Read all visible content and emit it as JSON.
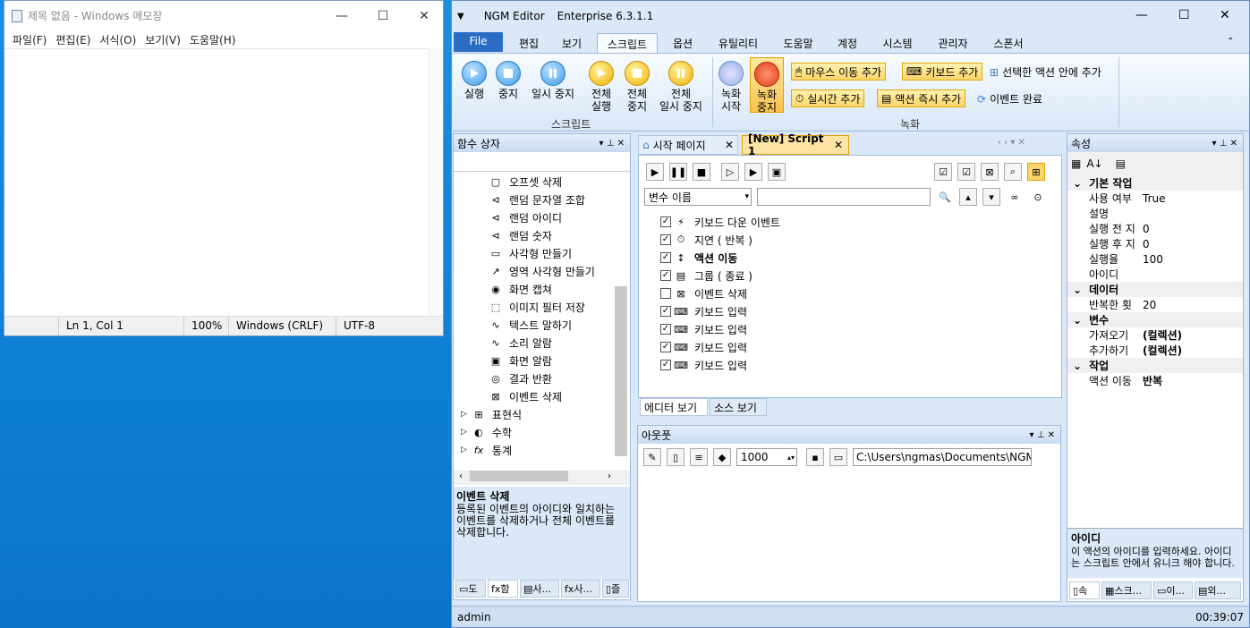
{
  "notepad": {
    "title": "제목 없음 - Windows 메모장",
    "menu": [
      "파일(F)",
      "편집(E)",
      "서식(O)",
      "보기(V)",
      "도움말(H)"
    ],
    "status": {
      "pos": "Ln 1, Col 1",
      "zoom": "100%",
      "eol": "Windows (CRLF)",
      "enc": "UTF-8"
    }
  },
  "ngm": {
    "app": "NGM Editor",
    "edition": "Enterprise 6.3.1.1",
    "tabs": [
      "File",
      "편집",
      "보기",
      "스크립트",
      "옵션",
      "유틸리티",
      "도움말",
      "계정",
      "시스템",
      "관리자",
      "스폰서"
    ],
    "ribbon": {
      "run": "실행",
      "stop": "중지",
      "pause": "일시 중지",
      "run_all_1": "전체",
      "run_all_2": "실행",
      "stop_all_1": "전체",
      "stop_all_2": "중지",
      "pause_all_1": "전체",
      "pause_all_2": "일시 중지",
      "group_script": "스크립트",
      "rec_start_1": "녹화",
      "rec_start_2": "시작",
      "rec_stop_1": "녹화",
      "rec_stop_2": "중지",
      "mouse_add": "마우스 이동 추가",
      "kbd_add": "키보드 추가",
      "sel_add": "선택한 액션 안에 추가",
      "time_add": "실시간 추가",
      "action_add": "액션 즉시 추가",
      "event_done": "이벤트 완료",
      "group_rec": "녹화"
    },
    "func_panel": {
      "title": "함수 상자",
      "items": [
        "오프셋 삭제",
        "랜덤 문자열 조합",
        "랜덤 아이디",
        "랜덤 숫자",
        "사각형 만들기",
        "영역 사각형 만들기",
        "화면 캡쳐",
        "이미지 필터 저장",
        "텍스트 말하기",
        "소리 알람",
        "화면 알람",
        "결과 반환",
        "이벤트 삭제"
      ],
      "groups": [
        "표현식",
        "수학",
        "통계"
      ],
      "desc_title": "이벤트 삭제",
      "desc": "등록된 이벤트의 아이디와 일치하는 이벤트를 삭제하거나 전체 이벤트를 삭제합니다.",
      "bottom_tabs": [
        "도",
        "함",
        "사...",
        "사...",
        "즐"
      ]
    },
    "doc_tabs": [
      "시작 페이지",
      "[New] Script 1"
    ],
    "var_select": "변수 이름",
    "actions": [
      {
        "label": "키보드 다운 이벤트",
        "checked": true,
        "bold": false
      },
      {
        "label": "지연 ( 반복 )",
        "checked": true,
        "bold": false
      },
      {
        "label": "액션 이동",
        "checked": true,
        "bold": true
      },
      {
        "label": "그룹 ( 종료 )",
        "checked": true,
        "bold": false
      },
      {
        "label": "이벤트 삭제",
        "checked": false,
        "bold": false
      },
      {
        "label": "키보드 입력",
        "checked": true,
        "bold": false
      },
      {
        "label": "키보드 입력",
        "checked": true,
        "bold": false
      },
      {
        "label": "키보드 입력",
        "checked": true,
        "bold": false
      },
      {
        "label": "키보드 입력",
        "checked": true,
        "bold": false
      }
    ],
    "editor_tabs": [
      "에디터 보기",
      "소스 보기"
    ],
    "output": {
      "title": "아웃풋",
      "interval": "1000",
      "path": "C:\\Users\\ngmas\\Documents\\NGM6\\"
    },
    "props": {
      "title": "속성",
      "sections": [
        {
          "name": "기본 작업",
          "rows": [
            [
              "사용 여부",
              "True"
            ],
            [
              "설명",
              ""
            ],
            [
              "실행 전 지",
              "0"
            ],
            [
              "실행 후 지",
              "0"
            ],
            [
              "실행율",
              "100"
            ],
            [
              "아이디",
              ""
            ]
          ]
        },
        {
          "name": "데이터",
          "rows": [
            [
              "반복한 횟",
              "20"
            ]
          ]
        },
        {
          "name": "변수",
          "rows": [
            [
              "가져오기",
              "(컬렉션)"
            ],
            [
              "추가하기",
              "(컬렉션)"
            ]
          ]
        },
        {
          "name": "작업",
          "rows": [
            [
              "액션 이동",
              "반복"
            ]
          ]
        }
      ],
      "desc_title": "아이디",
      "desc": "이 액션의 아이디를 입력하세요. 아이디는 스크립트 안에서 유니크 해야 합니다.",
      "bottom_tabs": [
        "속",
        "스크...",
        "이...",
        "외..."
      ]
    },
    "status": {
      "user": "admin",
      "time": "00:39:07"
    }
  }
}
